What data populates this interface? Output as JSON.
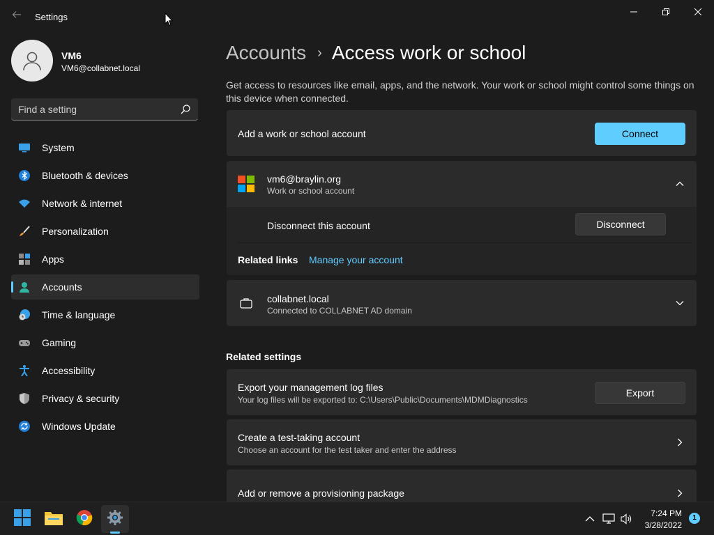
{
  "window": {
    "title": "Settings"
  },
  "profile": {
    "name": "VM6",
    "email": "VM6@collabnet.local"
  },
  "search": {
    "placeholder": "Find a setting"
  },
  "sidebar": {
    "items": [
      {
        "label": "System",
        "icon": "system-icon"
      },
      {
        "label": "Bluetooth & devices",
        "icon": "bluetooth-icon"
      },
      {
        "label": "Network & internet",
        "icon": "wifi-icon"
      },
      {
        "label": "Personalization",
        "icon": "brush-icon"
      },
      {
        "label": "Apps",
        "icon": "apps-icon"
      },
      {
        "label": "Accounts",
        "icon": "accounts-icon",
        "active": true
      },
      {
        "label": "Time & language",
        "icon": "clock-globe-icon"
      },
      {
        "label": "Gaming",
        "icon": "gamepad-icon"
      },
      {
        "label": "Accessibility",
        "icon": "accessibility-icon"
      },
      {
        "label": "Privacy & security",
        "icon": "shield-icon"
      },
      {
        "label": "Windows Update",
        "icon": "update-icon"
      }
    ]
  },
  "breadcrumb": {
    "parent": "Accounts",
    "separator": "›",
    "current": "Access work or school"
  },
  "description": "Get access to resources like email, apps, and the network. Your work or school might control some things on this device when connected.",
  "add_account": {
    "label": "Add a work or school account",
    "button": "Connect"
  },
  "account_braylin": {
    "email": "vm6@braylin.org",
    "type": "Work or school account",
    "disconnect_label": "Disconnect this account",
    "disconnect_button": "Disconnect",
    "related_links_label": "Related links",
    "manage_link": "Manage your account"
  },
  "account_collabnet": {
    "name": "collabnet.local",
    "status": "Connected to COLLABNET AD domain"
  },
  "related_settings": {
    "heading": "Related settings",
    "export": {
      "title": "Export your management log files",
      "subtitle": "Your log files will be exported to: C:\\Users\\Public\\Documents\\MDMDiagnostics",
      "button": "Export"
    },
    "test_account": {
      "title": "Create a test-taking account",
      "subtitle": "Choose an account for the test taker and enter the address"
    },
    "provisioning": {
      "title": "Add or remove a provisioning package"
    }
  },
  "taskbar": {
    "time": "7:24 PM",
    "date": "3/28/2022",
    "notification_count": "1"
  },
  "colors": {
    "accent": "#60cdff",
    "background": "#1c1c1c",
    "card": "#2b2b2b"
  }
}
